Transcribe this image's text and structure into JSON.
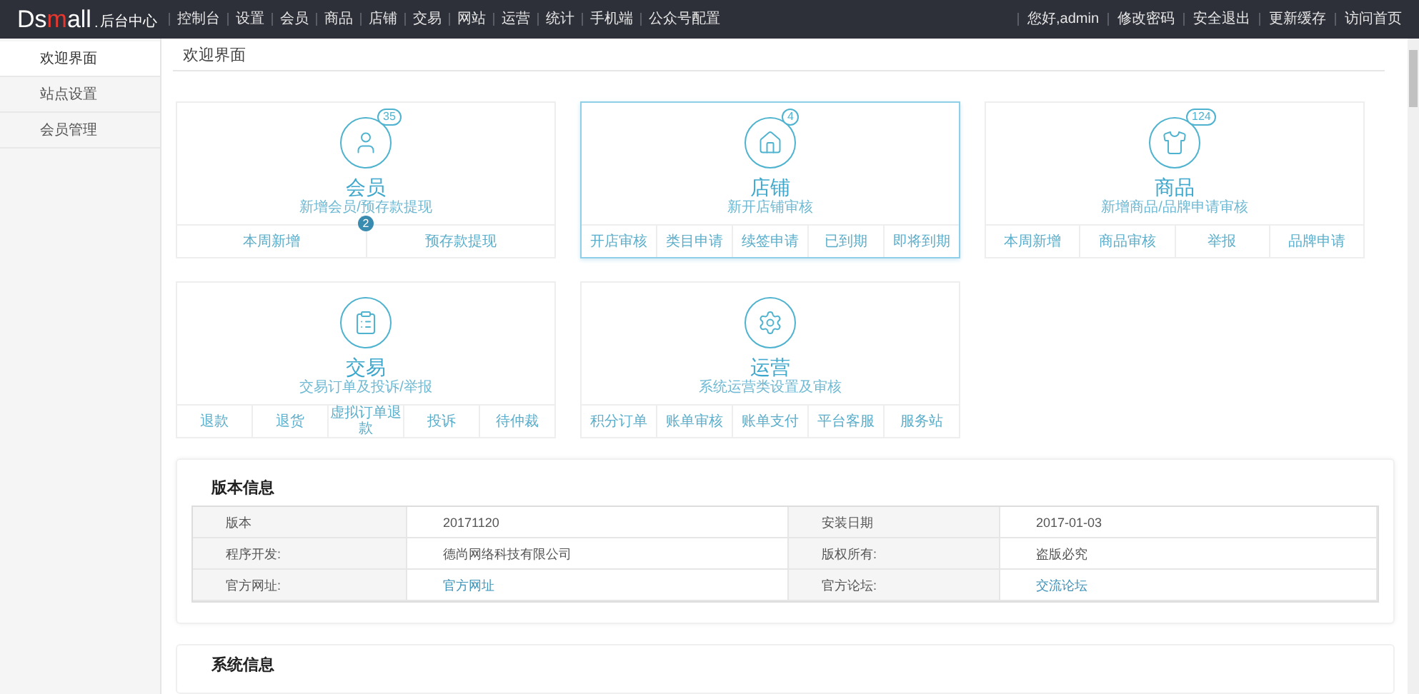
{
  "logo": {
    "parts": [
      {
        "text": "Ds",
        "accent": false
      },
      {
        "text": "m",
        "accent": true
      },
      {
        "text": "all",
        "accent": false
      }
    ],
    "dot": ".",
    "subtitle": "后台中心"
  },
  "nav": [
    {
      "label": "控制台"
    },
    {
      "label": "设置"
    },
    {
      "label": "会员"
    },
    {
      "label": "商品"
    },
    {
      "label": "店铺"
    },
    {
      "label": "交易"
    },
    {
      "label": "网站"
    },
    {
      "label": "运营"
    },
    {
      "label": "统计"
    },
    {
      "label": "手机端"
    },
    {
      "label": "公众号配置"
    }
  ],
  "user_links": [
    {
      "label": "您好,admin"
    },
    {
      "label": "修改密码"
    },
    {
      "label": "安全退出"
    },
    {
      "label": "更新缓存"
    },
    {
      "label": "访问首页"
    }
  ],
  "sidebar": {
    "items": [
      {
        "label": "欢迎界面",
        "selected": true
      },
      {
        "label": "站点设置",
        "selected": false
      },
      {
        "label": "会员管理",
        "selected": false
      }
    ]
  },
  "page_title": "欢迎界面",
  "cards": [
    {
      "kind": "user",
      "count": "35",
      "title": "会员",
      "subtitle": "新增会员/预存款提现",
      "highlighted": false,
      "marker": "2",
      "links": [
        "本周新增",
        "预存款提现"
      ]
    },
    {
      "kind": "house",
      "count": "4",
      "title": "店铺",
      "subtitle": "新开店铺审核",
      "highlighted": true,
      "links": [
        "开店审核",
        "类目申请",
        "续签申请",
        "已到期",
        "即将到期"
      ]
    },
    {
      "kind": "shirt",
      "count": "124",
      "title": "商品",
      "subtitle": "新增商品/品牌申请审核",
      "highlighted": false,
      "links": [
        "本周新增",
        "商品审核",
        "举报",
        "品牌申请"
      ]
    },
    {
      "kind": "receipt",
      "title": "交易",
      "subtitle": "交易订单及投诉/举报",
      "highlighted": false,
      "links": [
        "退款",
        "退货",
        "虚拟订单退款",
        "投诉",
        "待仲裁"
      ]
    },
    {
      "kind": "gear",
      "title": "运营",
      "subtitle": "系统运营类设置及审核",
      "highlighted": false,
      "links": [
        "积分订单",
        "账单审核",
        "账单支付",
        "平台客服",
        "服务站"
      ]
    }
  ],
  "version_panel": {
    "title": "版本信息",
    "rows": [
      [
        {
          "text": "版本",
          "kind": "label"
        },
        {
          "text": "20171120",
          "kind": "value"
        },
        {
          "text": "安装日期",
          "kind": "label"
        },
        {
          "text": "2017-01-03",
          "kind": "value"
        }
      ],
      [
        {
          "text": "程序开发:",
          "kind": "label"
        },
        {
          "text": "德尚网络科技有限公司",
          "kind": "value"
        },
        {
          "text": "版权所有:",
          "kind": "label"
        },
        {
          "text": "盗版必究",
          "kind": "value"
        }
      ],
      [
        {
          "text": "官方网址:",
          "kind": "label"
        },
        {
          "text": "官方网址",
          "kind": "link"
        },
        {
          "text": "官方论坛:",
          "kind": "label"
        },
        {
          "text": "交流论坛",
          "kind": "link"
        }
      ]
    ]
  },
  "system_panel": {
    "title": "系统信息"
  }
}
